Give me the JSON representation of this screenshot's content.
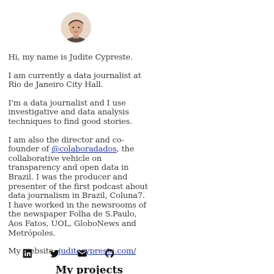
{
  "profile": {
    "avatar_icon": "profile-photo",
    "greeting": "Hi, my name is Judite Cypreste.",
    "current_role": "I am currently a data journalist at Rio de Janeiro City Hall.",
    "approach": "I'm a data journalist and I use investigative and data analysis techniques to find good stories.",
    "bio_prefix": "I am also the director and co-founder of ",
    "bio_link": "@colaboradados",
    "bio_suffix": ", the collaborative vehicle on transparency and open data in Brazil. I was the producer and presenter of the first podcast about data journalism in Brazil, Coluna7. I have worked in the newsrooms of the newspaper Folha de S.Paulo, Aos Fatos, UOL, GloboNews and Metrópoles.",
    "website_label": "My website: ",
    "website_link": "juditecypreste.com/"
  },
  "socials": [
    {
      "icon": "linkedin-icon"
    },
    {
      "icon": "twitter-icon"
    },
    {
      "icon": "email-icon"
    },
    {
      "icon": "github-icon"
    }
  ],
  "projects": {
    "heading": "My projects"
  },
  "colors": {
    "text": "#3a3a3a",
    "link": "#2438b8",
    "heading": "#111111",
    "icon": "#111111"
  }
}
